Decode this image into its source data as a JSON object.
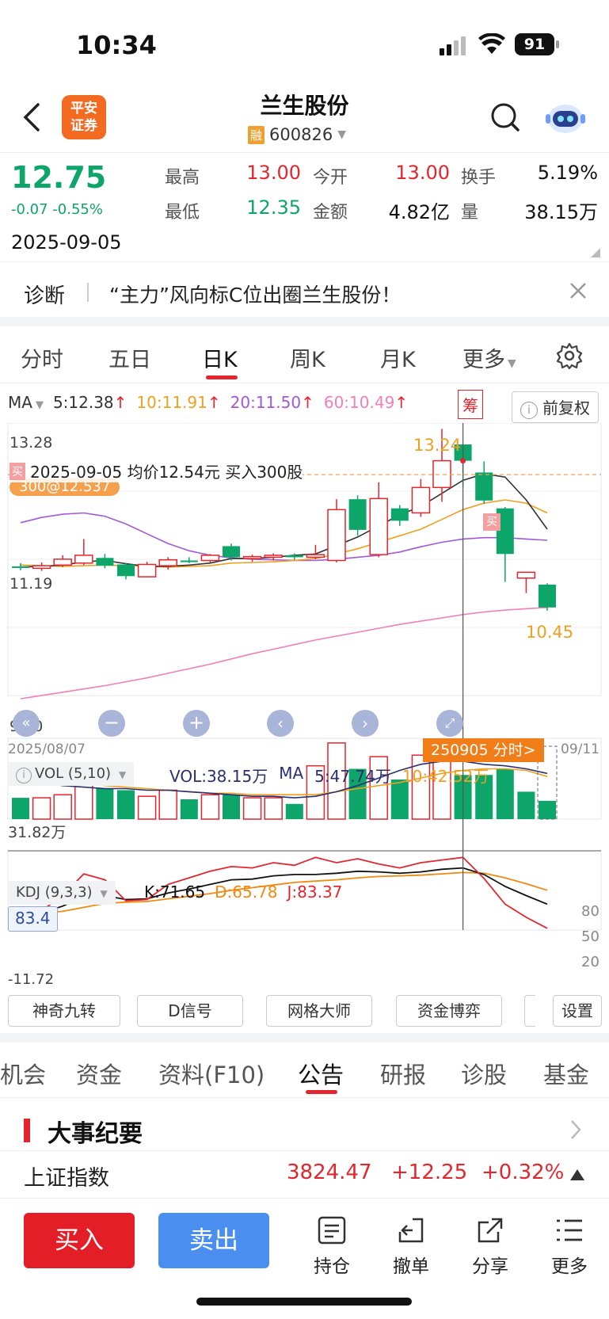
{
  "status_bar": {
    "time": "10:34",
    "battery": "91"
  },
  "header": {
    "logo_line1": "平安",
    "logo_line2": "证券",
    "title": "兰生股份",
    "margin_badge": "融",
    "code": "600826"
  },
  "quote": {
    "price": "12.75",
    "change": "-0.07 -0.55%",
    "date": "2025-09-05",
    "fields": [
      {
        "label": "最高",
        "value": "13.00",
        "color": "red"
      },
      {
        "label": "今开",
        "value": "13.00",
        "color": "red"
      },
      {
        "label": "换手",
        "value": "5.19%",
        "color": "black"
      },
      {
        "label": "最低",
        "value": "12.35",
        "color": "green"
      },
      {
        "label": "金额",
        "value": "4.82亿",
        "color": "black"
      },
      {
        "label": "量",
        "value": "38.15万",
        "color": "black"
      }
    ]
  },
  "diagnosis": {
    "label": "诊断",
    "text": "“主力”风向标C位出圈兰生股份！"
  },
  "chart_tabs": [
    "分时",
    "五日",
    "日K",
    "周K",
    "月K",
    "更多"
  ],
  "active_chart_tab": "日K",
  "ma_row": {
    "label": "MA",
    "ma5": "5:12.38",
    "ma10": "10:11.91",
    "ma20": "20:11.50",
    "ma60": "60:10.49",
    "chip_label": "筹",
    "adjust_label": "前复权"
  },
  "kline_labels": {
    "top_price": "13.28",
    "mid_price": "11.19",
    "low_price": "9.10",
    "high_mark": "13.24",
    "low_mark": "10.45",
    "buy_badge": "买",
    "trade_note": "2025-09-05 均价12.54元 买入300股",
    "trade_tag": "300@12.537",
    "start_date": "2025/08/07",
    "end_date": "09/11",
    "crosshair_tag": "250905 分时>"
  },
  "vol_labels": {
    "indicator": "VOL (5,10)",
    "vol": "VOL:38.15万",
    "ma_label": "MA",
    "ma5": "5:47.74万",
    "ma10": "10:42.52万",
    "axis": "31.82万"
  },
  "kdj_labels": {
    "indicator": "KDJ (9,3,3)",
    "k": "K:71.65",
    "d": "D:65.78",
    "j": "J:83.37",
    "value_box": "83.4",
    "axis_low": "-11.72",
    "lvl80": "80",
    "lvl50": "50",
    "lvl20": "20"
  },
  "chart_data": [
    {
      "type": "candlestick",
      "title": "日K",
      "x_range": [
        "2025/08/07",
        "09/11"
      ],
      "ylim": [
        9.1,
        13.28
      ],
      "candles": [
        {
          "o": 11.13,
          "c": 11.13,
          "h": 11.18,
          "l": 11.07,
          "up": false
        },
        {
          "o": 11.1,
          "c": 11.14,
          "h": 11.19,
          "l": 11.06,
          "up": true
        },
        {
          "o": 11.15,
          "c": 11.24,
          "h": 11.3,
          "l": 11.12,
          "up": true
        },
        {
          "o": 11.18,
          "c": 11.3,
          "h": 11.55,
          "l": 11.15,
          "up": true
        },
        {
          "o": 11.26,
          "c": 11.14,
          "h": 11.32,
          "l": 11.1,
          "up": false
        },
        {
          "o": 11.16,
          "c": 10.98,
          "h": 11.18,
          "l": 10.93,
          "up": false
        },
        {
          "o": 10.97,
          "c": 11.16,
          "h": 11.2,
          "l": 10.96,
          "up": true
        },
        {
          "o": 11.14,
          "c": 11.23,
          "h": 11.27,
          "l": 11.08,
          "up": true
        },
        {
          "o": 11.22,
          "c": 11.21,
          "h": 11.27,
          "l": 11.18,
          "up": false
        },
        {
          "o": 11.22,
          "c": 11.3,
          "h": 11.32,
          "l": 11.19,
          "up": true
        },
        {
          "o": 11.44,
          "c": 11.27,
          "h": 11.48,
          "l": 11.22,
          "up": false
        },
        {
          "o": 11.25,
          "c": 11.28,
          "h": 11.31,
          "l": 11.2,
          "up": true
        },
        {
          "o": 11.27,
          "c": 11.3,
          "h": 11.33,
          "l": 11.22,
          "up": true
        },
        {
          "o": 11.3,
          "c": 11.27,
          "h": 11.33,
          "l": 11.23,
          "up": false
        },
        {
          "o": 11.27,
          "c": 11.31,
          "h": 11.46,
          "l": 11.24,
          "up": true
        },
        {
          "o": 11.22,
          "c": 12.0,
          "h": 12.16,
          "l": 11.19,
          "up": true
        },
        {
          "o": 12.16,
          "c": 11.69,
          "h": 12.22,
          "l": 11.6,
          "up": false
        },
        {
          "o": 11.31,
          "c": 12.17,
          "h": 12.42,
          "l": 11.27,
          "up": true
        },
        {
          "o": 12.02,
          "c": 11.83,
          "h": 12.07,
          "l": 11.75,
          "up": false
        },
        {
          "o": 11.95,
          "c": 12.34,
          "h": 12.47,
          "l": 11.89,
          "up": true
        },
        {
          "o": 12.34,
          "c": 12.75,
          "h": 13.24,
          "l": 12.12,
          "up": true
        },
        {
          "o": 13.0,
          "c": 12.75,
          "h": 13.0,
          "l": 12.35,
          "up": false
        },
        {
          "o": 12.57,
          "c": 12.14,
          "h": 12.74,
          "l": 12.09,
          "up": false
        },
        {
          "o": 12.02,
          "c": 11.32,
          "h": 12.04,
          "l": 10.89,
          "up": false
        },
        {
          "o": 10.95,
          "c": 11.04,
          "h": 11.05,
          "l": 10.72,
          "up": true
        },
        {
          "o": 10.85,
          "c": 10.5,
          "h": 10.87,
          "l": 10.45,
          "up": false
        }
      ],
      "ma5": [
        11.12,
        11.13,
        11.15,
        11.2,
        11.22,
        11.17,
        11.13,
        11.13,
        11.15,
        11.18,
        11.25,
        11.25,
        11.27,
        11.3,
        11.32,
        11.45,
        11.58,
        11.75,
        11.92,
        12.05,
        12.25,
        12.45,
        12.55,
        12.5,
        12.15,
        11.7
      ],
      "ma10": [
        11.15,
        11.14,
        11.13,
        11.14,
        11.15,
        11.14,
        11.13,
        11.12,
        11.13,
        11.14,
        11.18,
        11.19,
        11.2,
        11.22,
        11.25,
        11.32,
        11.4,
        11.5,
        11.6,
        11.7,
        11.85,
        12.0,
        12.1,
        12.15,
        12.1,
        11.95
      ],
      "ma20": [
        11.8,
        11.88,
        11.93,
        11.95,
        11.9,
        11.78,
        11.63,
        11.48,
        11.37,
        11.3,
        11.26,
        11.24,
        11.23,
        11.22,
        11.22,
        11.24,
        11.27,
        11.3,
        11.35,
        11.43,
        11.5,
        11.55,
        11.57,
        11.57,
        11.55,
        11.53
      ],
      "ma60": [
        9.1,
        9.15,
        9.2,
        9.25,
        9.3,
        9.36,
        9.42,
        9.49,
        9.56,
        9.63,
        9.71,
        9.79,
        9.86,
        9.93,
        10.0,
        10.06,
        10.12,
        10.18,
        10.24,
        10.29,
        10.34,
        10.39,
        10.43,
        10.46,
        10.48,
        10.5
      ]
    },
    {
      "type": "bar",
      "title": "VOL (5,10)",
      "unit": "万",
      "values": [
        14,
        14,
        16,
        36,
        20,
        19,
        15,
        19,
        13,
        16,
        16,
        14,
        14,
        10,
        35,
        50,
        33,
        41,
        26,
        42,
        43,
        29,
        29,
        33,
        18,
        12
      ],
      "up": [
        false,
        true,
        true,
        true,
        false,
        false,
        true,
        true,
        false,
        true,
        false,
        true,
        true,
        false,
        true,
        true,
        false,
        true,
        false,
        true,
        true,
        false,
        false,
        false,
        false,
        false
      ],
      "ma5": [
        26,
        24,
        22,
        21,
        20,
        20,
        19,
        19,
        18,
        17,
        16,
        15,
        15,
        14,
        15,
        18,
        22,
        27,
        32,
        36,
        38,
        38,
        36,
        35,
        33,
        30
      ],
      "ma10": [
        28,
        27,
        25,
        24,
        22,
        21,
        20,
        19,
        18,
        17,
        17,
        16,
        16,
        16,
        16,
        18,
        20,
        22,
        24,
        27,
        30,
        32,
        33,
        33,
        32,
        28
      ]
    },
    {
      "type": "line",
      "title": "KDJ (9,3,3)",
      "levels": [
        80,
        50,
        20
      ],
      "k": [
        8,
        12,
        22,
        37,
        38,
        32,
        33,
        42,
        48,
        55,
        62,
        63,
        68,
        70,
        70,
        72,
        75,
        74,
        72,
        74,
        78,
        80,
        70,
        52,
        38,
        25
      ],
      "d": [
        10,
        11,
        14,
        20,
        26,
        28,
        29,
        33,
        37,
        41,
        46,
        50,
        54,
        58,
        60,
        62,
        65,
        67,
        68,
        69,
        71,
        73,
        72,
        65,
        56,
        46
      ],
      "j": [
        5,
        15,
        38,
        71,
        62,
        30,
        32,
        55,
        65,
        75,
        82,
        80,
        88,
        84,
        96,
        88,
        94,
        86,
        80,
        88,
        92,
        96,
        64,
        25,
        5,
        -11.72
      ]
    }
  ],
  "tool_buttons": [
    "神奇九转",
    "D信号",
    "网格大师",
    "资金博弈",
    "设置"
  ],
  "function_tabs": [
    "机会",
    "资金",
    "资料(F10)",
    "公告",
    "研报",
    "诊股",
    "基金"
  ],
  "active_function_tab": "公告",
  "event_section": {
    "title": "大事纪要"
  },
  "index_bar": {
    "name": "上证指数",
    "value": "3824.47",
    "change": "+12.25",
    "pct": "+0.32%"
  },
  "actions": {
    "buy": "买入",
    "sell": "卖出",
    "nav": [
      "持仓",
      "撤单",
      "分享",
      "更多"
    ]
  },
  "colors": {
    "up": "#e3262e",
    "down": "#0da56a",
    "ma5": "#333333",
    "ma10": "#f0a020",
    "ma20": "#a05ad8",
    "ma60": "#f080b8",
    "sell_button": "#4a8ff0",
    "tag_orange": "#f07d18"
  }
}
